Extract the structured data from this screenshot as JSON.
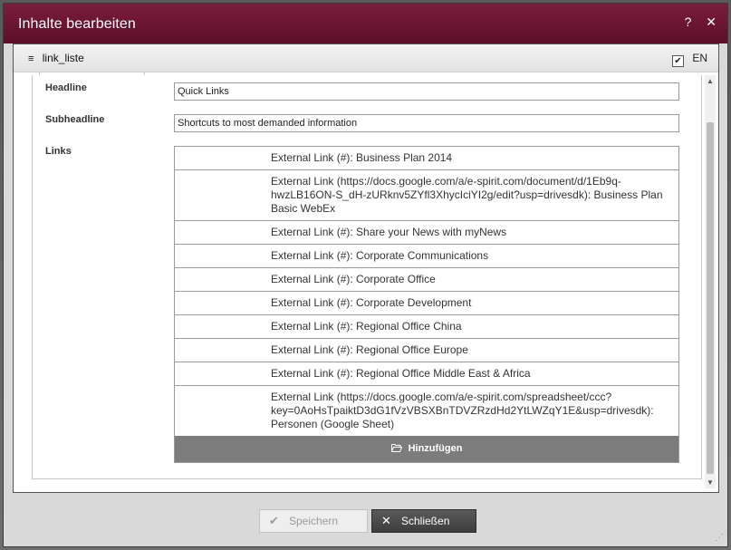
{
  "dialog": {
    "title": "Inhalte bearbeiten",
    "help_icon": "?",
    "close_icon": "✕"
  },
  "panel": {
    "title": "link_liste",
    "language": "EN",
    "language_checked": true
  },
  "fields": {
    "headline_label": "Headline",
    "headline_value": "Quick Links",
    "subheadline_label": "Subheadline",
    "subheadline_value": "Shortcuts to most demanded information",
    "links_label": "Links"
  },
  "links": [
    "External Link (#): Business Plan 2014",
    "External Link (https://docs.google.com/a/e-spirit.com/document/d/1Eb9q-hwzLB16ON-S_dH-zURknv5ZYfl3XhycIciYI2g/edit?usp=drivesdk): Business Plan Basic WebEx",
    "External Link (#): Share your News with myNews",
    "External Link (#): Corporate Communications",
    "External Link (#): Corporate Office",
    "External Link (#): Corporate Development",
    "External Link (#): Regional Office China",
    "External Link (#): Regional Office Europe",
    "External Link (#): Regional Office Middle East & Africa",
    "External Link (https://docs.google.com/a/e-spirit.com/spreadsheet/ccc?key=0AoHsTpaiktD3dG1fVzVBSXBnTDVZRzdHd2YtLWZqY1E&usp=drivesdk): Personen (Google Sheet)"
  ],
  "add_button": "Hinzufügen",
  "footer": {
    "save_label": "Speichern",
    "close_label": "Schließen"
  },
  "icons": {
    "menu": "hamburger-icon",
    "checkbox": "checkbox-icon",
    "folder": "folder-open-icon",
    "save": "checkmark-icon",
    "close": "close-icon"
  },
  "colors": {
    "titlebar": "#6a1532",
    "add_bar": "#7c7c7c"
  }
}
